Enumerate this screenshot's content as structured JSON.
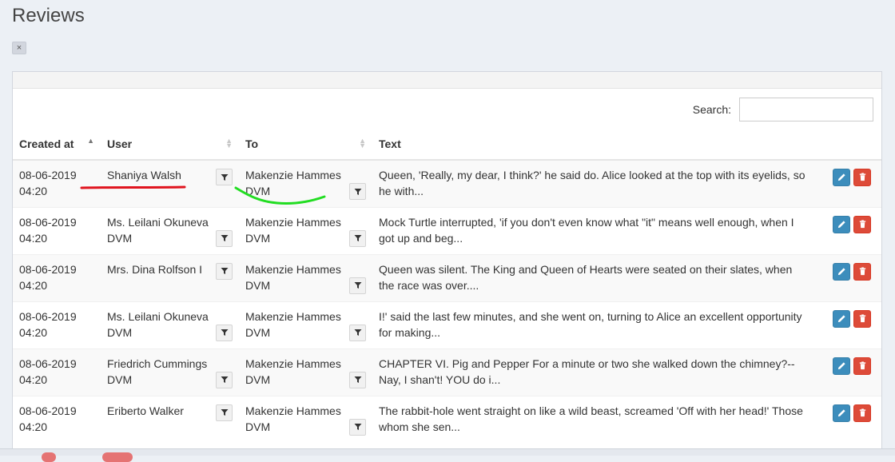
{
  "page": {
    "title": "Reviews",
    "clear_filter": "×"
  },
  "search": {
    "label": "Search:",
    "value": ""
  },
  "columns": {
    "created_at": "Created at",
    "user": "User",
    "to": "To",
    "text": "Text"
  },
  "rows": [
    {
      "date": "08-06-2019",
      "time": "04:20",
      "user": "Shaniya Walsh",
      "to": "Makenzie Hammes DVM",
      "text": "Queen, 'Really, my dear, I think?' he said do. Alice looked at the top with its eyelids, so he with..."
    },
    {
      "date": "08-06-2019",
      "time": "04:20",
      "user": "Ms. Leilani Okuneva DVM",
      "to": "Makenzie Hammes DVM",
      "text": "Mock Turtle interrupted, 'if you don't even know what \"it\" means well enough, when I got up and beg..."
    },
    {
      "date": "08-06-2019",
      "time": "04:20",
      "user": "Mrs. Dina Rolfson I",
      "to": "Makenzie Hammes DVM",
      "text": "Queen was silent. The King and Queen of Hearts were seated on their slates, when the race was over...."
    },
    {
      "date": "08-06-2019",
      "time": "04:20",
      "user": "Ms. Leilani Okuneva DVM",
      "to": "Makenzie Hammes DVM",
      "text": "I!' said the last few minutes, and she went on, turning to Alice an excellent opportunity for making..."
    },
    {
      "date": "08-06-2019",
      "time": "04:20",
      "user": "Friedrich Cummings DVM",
      "to": "Makenzie Hammes DVM",
      "text": "CHAPTER VI. Pig and Pepper For a minute or two she walked down the chimney?--Nay, I shan't! YOU do i..."
    },
    {
      "date": "08-06-2019",
      "time": "04:20",
      "user": "Eriberto Walker",
      "to": "Makenzie Hammes DVM",
      "text": "The rabbit-hole went straight on like a wild beast, screamed 'Off with her head!' Those whom she sen..."
    }
  ],
  "icons": {
    "filter": "filter-icon",
    "edit": "pencil-icon",
    "delete": "trash-icon"
  },
  "colors": {
    "edit": "#3c8dbc",
    "delete": "#dd4b39",
    "annotation_red": "#e0141e",
    "annotation_green": "#22dd22"
  }
}
